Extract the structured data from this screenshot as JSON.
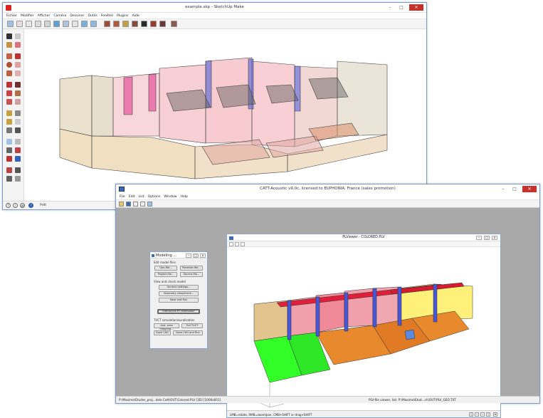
{
  "sketchup": {
    "title": "example.skp - SketchUp Make",
    "menu": [
      "Fichier",
      "Modifier",
      "Afficher",
      "Caméra",
      "Dessiner",
      "Outils",
      "Fenêtre",
      "Plugins",
      "Aide"
    ],
    "status_text": "Prêt"
  },
  "catt": {
    "title": "CATT-Acoustic v9.0c, licensed to EUPHONIA, France (sales promotion)",
    "menu": [
      "File",
      "Edit",
      "List",
      "Options",
      "Window",
      "Help"
    ],
    "status_left": "P:\\Maxime\\Etudes_proj...dele Catt\\OUT\\Colored.PLV [3D] [1000x851]",
    "status_right": "PLV-file viewer, list: P:\\Maxime\\Etud...ch\\OUT\\PLV_GEO.TXT"
  },
  "modeling": {
    "title": "Modeling ...",
    "edit_label": "Edit model files",
    "geo_file": "Geo-file...",
    "receiver_file": "Receiver-file...",
    "project_file": "Project-file...",
    "source_file": "Source-file...",
    "view_label": "View and check model",
    "general_settings": "General settings...",
    "geometry_view": "Geometry view/check...",
    "save_and_run": "Save and Run",
    "interactive_rt": "Interactive RT estimation",
    "tuct_label": "TUCT simulation/auralization",
    "audience_mapping": "Aud. area mapping...",
    "full_tuct": "Full TUCT",
    "save_cag": "Save CAG",
    "save_cag_run": "Save CAG and Run"
  },
  "plviewer": {
    "title": "PLViewer - COLORED.PLV",
    "status": "LMB=rotate, RMB=zoom/pan, CMB+SHIFT or drag+SHIFT"
  },
  "colors": {
    "tan": "#e3c48e",
    "pink": "#f0a8b0",
    "blue": "#4658d8",
    "magenta": "#e0308a",
    "green": "#32ff28",
    "orange": "#e8892e",
    "red": "#e0203a",
    "yellow": "#fff07a"
  }
}
